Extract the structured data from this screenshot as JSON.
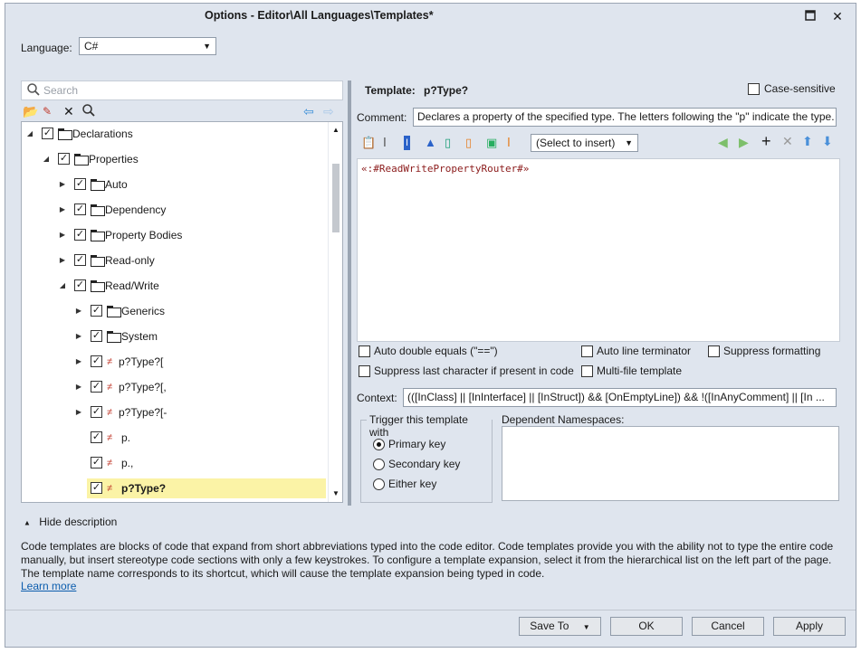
{
  "window": {
    "title": "Options - Editor\\All Languages\\Templates*",
    "maximize_icon": "maximize-icon",
    "close_icon": "close-icon"
  },
  "language": {
    "label": "Language:",
    "value": "C#"
  },
  "search": {
    "placeholder": "Search"
  },
  "tree": {
    "items": [
      {
        "label": "Declarations",
        "level": 0,
        "expanded": true,
        "checked": true,
        "icon": "folder-icon"
      },
      {
        "label": "Properties",
        "level": 1,
        "expanded": true,
        "checked": true,
        "icon": "folder-icon"
      },
      {
        "label": "Auto",
        "level": 2,
        "expanded": false,
        "checked": true,
        "icon": "folder-icon"
      },
      {
        "label": "Dependency",
        "level": 2,
        "expanded": false,
        "checked": true,
        "icon": "folder-icon"
      },
      {
        "label": "Property Bodies",
        "level": 2,
        "expanded": false,
        "checked": true,
        "icon": "folder-icon"
      },
      {
        "label": "Read-only",
        "level": 2,
        "expanded": false,
        "checked": true,
        "icon": "folder-icon"
      },
      {
        "label": "Read/Write",
        "level": 2,
        "expanded": true,
        "checked": true,
        "icon": "folder-icon"
      },
      {
        "label": "Generics",
        "level": 3,
        "expanded": false,
        "checked": true,
        "icon": "folder-icon"
      },
      {
        "label": "System",
        "level": 3,
        "expanded": false,
        "checked": true,
        "icon": "folder-icon"
      },
      {
        "label": "p?Type?[",
        "level": 3,
        "expanded": false,
        "checked": true,
        "icon": "template-icon"
      },
      {
        "label": "p?Type?[,",
        "level": 3,
        "expanded": false,
        "checked": true,
        "icon": "template-icon"
      },
      {
        "label": "p?Type?[-",
        "level": 3,
        "expanded": false,
        "checked": true,
        "icon": "template-icon"
      },
      {
        "label": "p.",
        "level": 3,
        "checked": true,
        "icon": "template-icon"
      },
      {
        "label": "p.,",
        "level": 3,
        "checked": true,
        "icon": "template-icon"
      },
      {
        "label": "p?Type?",
        "level": 3,
        "checked": true,
        "icon": "template-icon",
        "selected": true
      }
    ]
  },
  "template": {
    "label": "Template:",
    "name": "p?Type?",
    "case_sensitive_label": "Case-sensitive",
    "comment_label": "Comment:",
    "comment_value": "Declares a property of the specified type. The letters following the \"p\" indicate the type.",
    "insert_placeholder": "(Select to insert)",
    "code": "«:#ReadWritePropertyRouter#»"
  },
  "options": {
    "auto_double_equals": "Auto double equals (\"==\")",
    "auto_line_terminator": "Auto line terminator",
    "suppress_formatting": "Suppress formatting",
    "suppress_last_char": "Suppress last character if present in code",
    "multi_file": "Multi-file template"
  },
  "context": {
    "label": "Context:",
    "value": "(([InClass] || [InInterface] || [InStruct]) && [OnEmptyLine]) && !([InAnyComment] || [In ..."
  },
  "trigger": {
    "title": "Trigger this template with",
    "options": [
      "Primary key",
      "Secondary key",
      "Either key"
    ],
    "selected": "Primary key"
  },
  "namespaces": {
    "label": "Dependent Namespaces:"
  },
  "description": {
    "toggle": "Hide description",
    "text": "Code templates are blocks of code that expand from short abbreviations typed into the code editor. Code templates provide you with the ability not to type the entire code manually, but insert stereotype code sections with only a few keystrokes. To configure a template expansion, select it from the hierarchical list on the left part of the page. The template name corresponds to its shortcut, which will cause the template expansion being typed in code.",
    "link": "Learn more"
  },
  "buttons": {
    "save_to": "Save To",
    "ok": "OK",
    "cancel": "Cancel",
    "apply": "Apply"
  }
}
